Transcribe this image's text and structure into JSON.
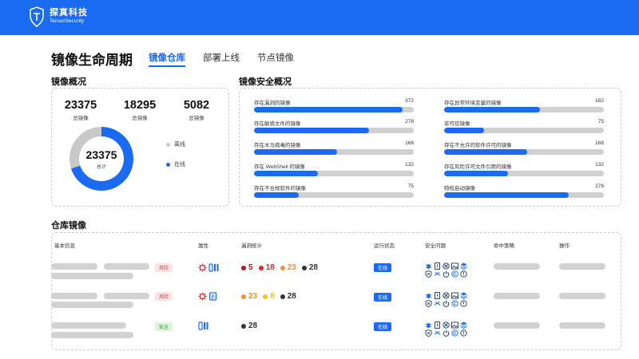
{
  "header": {
    "brand_name": "探真科技",
    "brand_sub": "TensorSecurity",
    "color": "#1a6bf2"
  },
  "page": {
    "title": "镜像生命周期",
    "tabs": [
      {
        "label": "镜像仓库",
        "active": true
      },
      {
        "label": "部署上线",
        "active": false
      },
      {
        "label": "节点镜像",
        "active": false
      }
    ]
  },
  "overview": {
    "title": "镜像概况",
    "stats": [
      {
        "value": "23375",
        "label": "总镜像"
      },
      {
        "value": "18295",
        "label": "总镜像"
      },
      {
        "value": "5082",
        "label": "总镜像"
      }
    ],
    "donut": {
      "value": "23375",
      "label": "总计",
      "online_fraction": 0.7
    },
    "legend": [
      {
        "label": "离线",
        "color": "#c8c8c8"
      },
      {
        "label": "在线",
        "color": "#1a6bf2"
      }
    ]
  },
  "security": {
    "title": "镜像安全概况",
    "left": [
      {
        "label": "存在漏洞的镜像",
        "value": "372",
        "fill": 0.93
      },
      {
        "label": "存在敏感文件的镜像",
        "value": "278",
        "fill": 0.72
      },
      {
        "label": "存在木马病毒的镜像",
        "value": "168",
        "fill": 0.52
      },
      {
        "label": "存在 WebShell 的镜像",
        "value": "132",
        "fill": 0.4
      },
      {
        "label": "存在不合规软件的镜像",
        "value": "75",
        "fill": 0.28
      }
    ],
    "right": [
      {
        "label": "存在异常环境变量的镜像",
        "value": "182",
        "fill": 0.6
      },
      {
        "label": "非可信镜像",
        "value": "75",
        "fill": 0.25
      },
      {
        "label": "存在不允许的软件许可的镜像",
        "value": "168",
        "fill": 0.52
      },
      {
        "label": "存在风险许可文件引用的镜像",
        "value": "132",
        "fill": 0.4
      },
      {
        "label": "特权启动镜像",
        "value": "278",
        "fill": 0.78
      }
    ]
  },
  "repo": {
    "title": "仓库镜像",
    "columns": [
      "基本信息",
      "属性",
      "漏洞统计",
      "运行状态",
      "安全问题",
      "命中策略",
      "操作"
    ],
    "rows": [
      {
        "tag": "风险",
        "tag_type": "risk",
        "status": "在线",
        "vulns": [
          {
            "count": "5",
            "color": "#c0152b"
          },
          {
            "count": "18",
            "color": "#e8252a"
          },
          {
            "count": "23",
            "color": "#f5922f"
          },
          {
            "count": "28",
            "color": "#333333"
          }
        ]
      },
      {
        "tag": "风险",
        "tag_type": "risk",
        "status": "在线",
        "vulns": [
          {
            "count": "23",
            "color": "#f5922f"
          },
          {
            "count": "8",
            "color": "#f5c518"
          },
          {
            "count": "28",
            "color": "#333333"
          }
        ]
      },
      {
        "tag": "安全",
        "tag_type": "safe",
        "status": "在线",
        "vulns": [
          {
            "count": "28",
            "color": "#333333"
          }
        ]
      }
    ]
  }
}
